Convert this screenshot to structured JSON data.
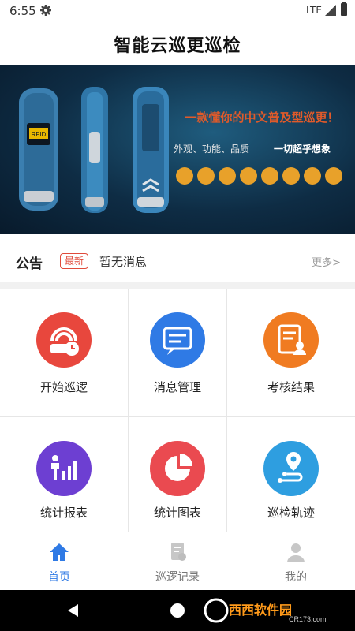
{
  "status": {
    "time": "6:55",
    "network": "LTE"
  },
  "app": {
    "title": "智能云巡更巡检"
  },
  "banner": {
    "slogan": "一款懂你的中文普及型巡更！",
    "tagline_left": "外观、功能、品质",
    "tagline_right": "一切超乎想象",
    "device_label": "RFID"
  },
  "notice": {
    "label": "公告",
    "badge": "最新",
    "message": "暂无消息",
    "more": "更多>"
  },
  "menu": [
    {
      "label": "开始巡逻",
      "icon": "patrol-icon",
      "color": "#e8473d"
    },
    {
      "label": "消息管理",
      "icon": "message-icon",
      "color": "#2f7ae5"
    },
    {
      "label": "考核结果",
      "icon": "result-icon",
      "color": "#f07b21"
    },
    {
      "label": "统计报表",
      "icon": "report-icon",
      "color": "#6d3fd2"
    },
    {
      "label": "统计图表",
      "icon": "pie-chart-icon",
      "color": "#ea4a50"
    },
    {
      "label": "巡检轨迹",
      "icon": "track-icon",
      "color": "#2e9ee0"
    }
  ],
  "tabs": [
    {
      "label": "首页",
      "icon": "home-icon",
      "active": true
    },
    {
      "label": "巡逻记录",
      "icon": "record-icon",
      "active": false
    },
    {
      "label": "我的",
      "icon": "user-icon",
      "active": false
    }
  ],
  "colors": {
    "active": "#2f7ae5",
    "inactive": "#777777",
    "accent": "#e04a3a"
  },
  "watermark": {
    "text": "西西软件园",
    "url": "CR173.com"
  }
}
